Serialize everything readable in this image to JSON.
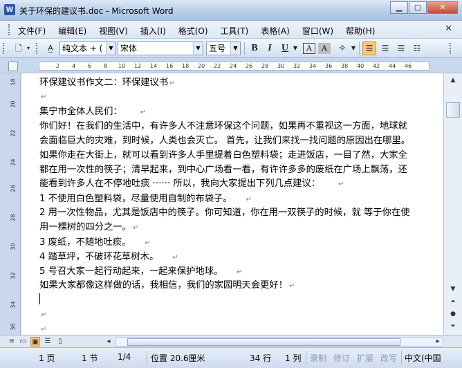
{
  "window": {
    "title": "关于环保的建议书.doc - Microsoft Word",
    "app_icon": "W"
  },
  "menu": [
    "文件(F)",
    "编辑(E)",
    "视图(V)",
    "插入(I)",
    "格式(O)",
    "工具(T)",
    "表格(A)",
    "窗口(W)",
    "帮助(H)"
  ],
  "toolbar": {
    "style": "纯文本 + (",
    "font": "宋体",
    "size": "五号",
    "bold": "B",
    "italic": "I",
    "underline": "U",
    "char_border": "A",
    "char_shading": "A"
  },
  "ruler": {
    "ticks": [
      "2",
      "4",
      "6",
      "8",
      "10",
      "12",
      "14",
      "16",
      "18",
      "20",
      "22",
      "24",
      "26",
      "28",
      "30",
      "32",
      "34",
      "36",
      "38",
      "40",
      "42",
      "44",
      "46"
    ],
    "vticks": [
      "18",
      "20",
      "22",
      "24",
      "26",
      "28",
      "30",
      "32",
      "34",
      "36"
    ]
  },
  "document": {
    "paragraphs": [
      "环保建议书作文二：环保建议书",
      "",
      "集宁市全体人民们：",
      "你们好！在我们的生活中，有许多人不注意环保这个问题，如果再不重视这一方面，地球就",
      "会面临巨大的灾难，到时候，人类也会灭亡。    首先，让我们来找一找问题的原因出在哪里。",
      "如果你走在大街上，就可以看到许多人手里提着白色塑料袋；走进饭店，一目了然，大家全",
      "都在用一次性的筷子；清早起来，到中心广场看一看，有许许多多的废纸在广场上飘荡，还",
      "能看到许多人在不停地吐痰 ······    所以，我向大家提出下列几点建议：",
      "1 不使用白色塑料袋，尽量使用自制的布袋子。",
      "2 用一次性物品，尤其是饭店中的筷子。你可知道，你在用一双筷子的时候，就 等于你在使",
      "用一棵树的四分之一。",
      "3 废纸，不随地吐痰。",
      "4 踏草坪，不破环花草树木。",
      "5 号召大家一起行动起来，一起来保护地球。",
      "如果大家都像这样做的话，我相信，我们的家园明天会更好！",
      "",
      "",
      ""
    ],
    "marks": [
      true,
      true,
      true,
      false,
      false,
      false,
      false,
      true,
      true,
      false,
      true,
      true,
      true,
      true,
      true,
      false,
      true,
      true
    ]
  },
  "status": {
    "page": "1 页",
    "section": "1 节",
    "page_of": "1/4",
    "position": "位置 20.6厘米",
    "line": "34 行",
    "column": "1 列",
    "rec": "录制",
    "trk": "修订",
    "ext": "扩展",
    "ovr": "改写",
    "language": "中文(中国"
  }
}
